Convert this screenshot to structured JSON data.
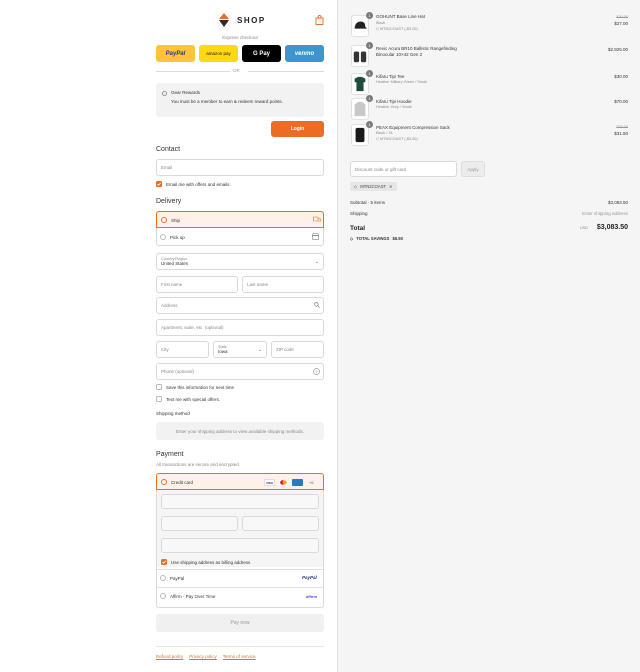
{
  "header": {
    "brand": "SHOP"
  },
  "express": {
    "label": "Express checkout",
    "buttons": [
      {
        "label": "PayPal",
        "bg": "#ffc439",
        "fg": "#253b80"
      },
      {
        "label": "amazon pay",
        "bg": "#ffd814",
        "fg": "#111111"
      },
      {
        "label": "G Pay",
        "bg": "#000000",
        "fg": "#ffffff"
      },
      {
        "label": "venmo",
        "bg": "#3d95ce",
        "fg": "#ffffff"
      }
    ],
    "or": "OR"
  },
  "rewards": {
    "title": "Gear Rewards",
    "text": "You must be a member to earn & redeem reward points.",
    "login": "Login"
  },
  "contact": {
    "heading": "Contact",
    "email_placeholder": "Email",
    "offers_label": "Email me with offers and emails."
  },
  "delivery": {
    "heading": "Delivery",
    "ship": "Ship",
    "pickup": "Pick up",
    "country_label": "Country/Region",
    "country_value": "United States",
    "first_name": "First name",
    "last_name": "Last name",
    "address": "Address",
    "apartment": "Apartment, suite, etc. (optional)",
    "city": "City",
    "state_label": "State",
    "state_value": "Iowa",
    "zip": "ZIP code",
    "phone": "Phone (optional)",
    "save_info": "Save this information for next time",
    "text_offers": "Text me with special offers."
  },
  "shipping_method": {
    "heading": "Shipping method",
    "message": "Enter your shipping address to view available shipping methods."
  },
  "payment": {
    "heading": "Payment",
    "subtitle": "All transactions are secure and encrypted.",
    "credit_card": "Credit card",
    "more_cards": "+6",
    "billing_same": "Use shipping address as billing address",
    "paypal": "PayPal",
    "paypal_logo": "PayPal",
    "affirm": "Affirm - Pay Over Time",
    "affirm_logo": "affirm",
    "pay_now": "Pay now"
  },
  "footer": {
    "links": [
      "Refund policy",
      "Privacy policy",
      "Terms of service"
    ]
  },
  "cart": {
    "items": [
      {
        "qty": "1",
        "name": "GOHUNT Base Line Hat",
        "sub": "Black",
        "discount": "MTN2COAST (-$3.00)",
        "orig": "$30.00",
        "price": "$27.00",
        "icon": "hat-icon"
      },
      {
        "qty": "1",
        "name": "Revic Acura BR10 Ballistic Rangefinding Binocular 10×42 Gen 2",
        "sub": "",
        "discount": "",
        "orig": "",
        "price": "$2,925.00",
        "icon": "binocular-icon"
      },
      {
        "qty": "1",
        "name": "Kifaru Tipi Tee",
        "sub": "Heather Military Green / Small",
        "discount": "",
        "orig": "",
        "price": "$30.00",
        "icon": "tee-icon"
      },
      {
        "qty": "1",
        "name": "Kifaru Tipi Hoodie",
        "sub": "Heather Grey / Small",
        "discount": "",
        "orig": "",
        "price": "$70.00",
        "icon": "hoodie-icon"
      },
      {
        "qty": "1",
        "name": "PEAX Equipment Compression Sack",
        "sub": "Black / XL",
        "discount": "MTN2COAST (-$3.50)",
        "orig": "$35.00",
        "price": "$31.50",
        "icon": "sack-icon"
      }
    ],
    "discount_placeholder": "Discount code or gift card",
    "apply": "Apply",
    "code_tag": "MTN2COAST",
    "subtotal_label": "Subtotal · 5 items",
    "subtotal_value": "$3,083.50",
    "shipping_label": "Shipping",
    "shipping_value": "Enter shipping address",
    "total_label": "Total",
    "currency": "USD",
    "total_value": "$3,083.50",
    "savings_label": "TOTAL SAVINGS",
    "savings_value": "$6.50"
  },
  "colors": {
    "accent": "#ec6b25",
    "panel": "#f5f5f5"
  }
}
